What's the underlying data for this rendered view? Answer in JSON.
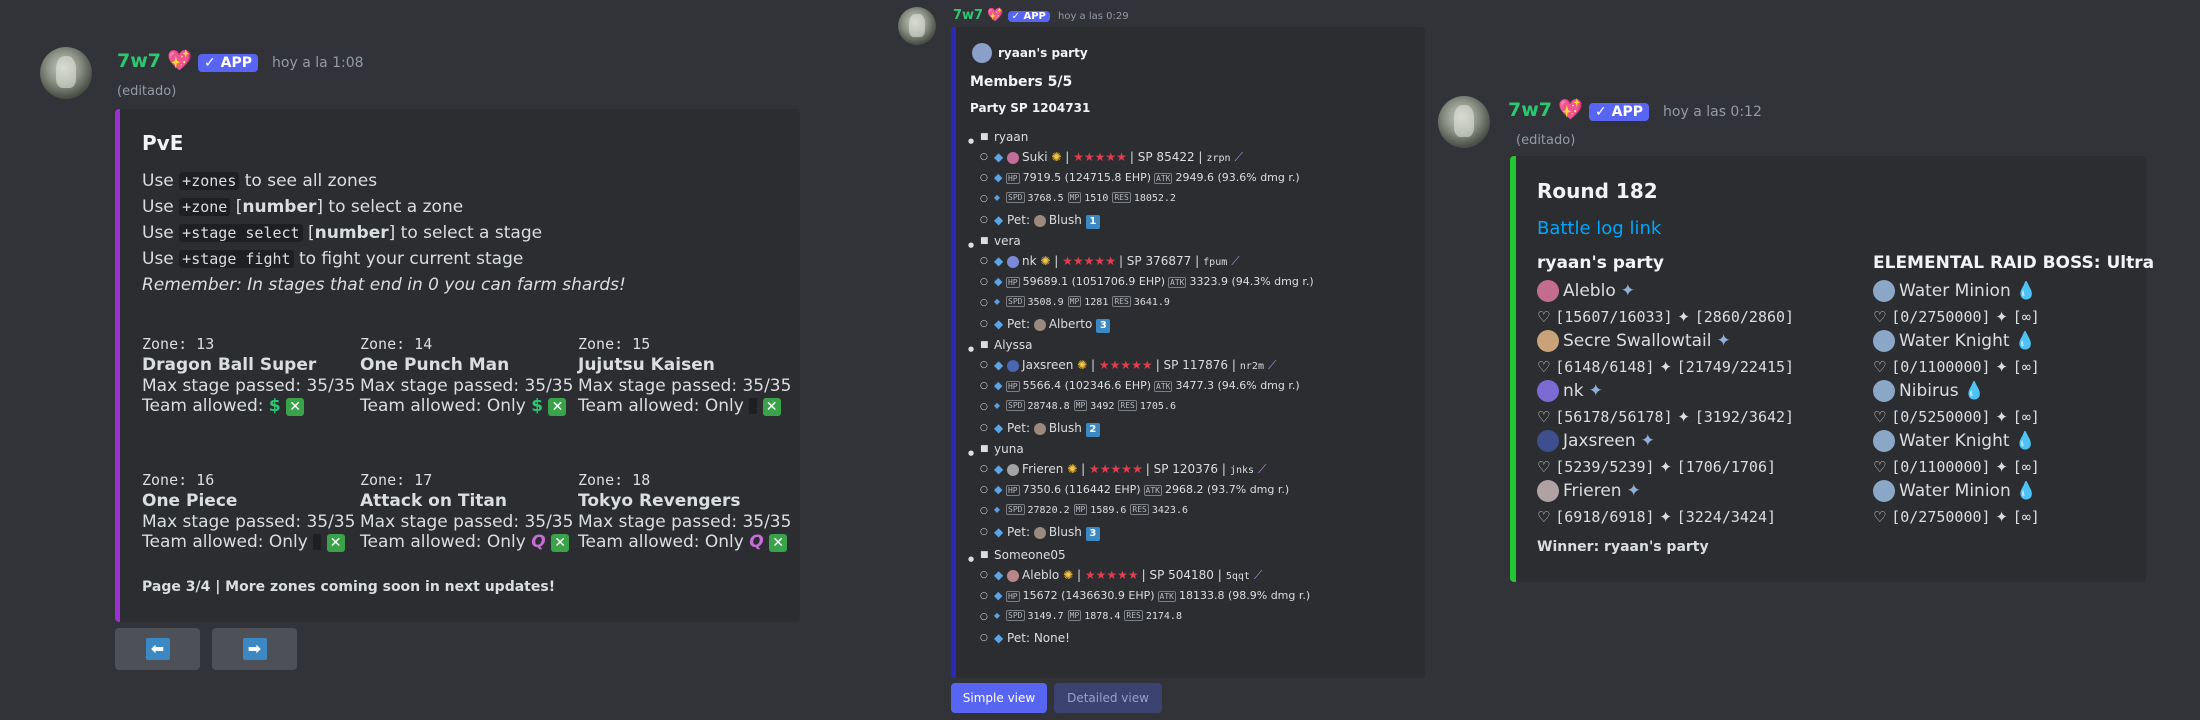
{
  "colors": {
    "background": "#313338",
    "embed_bg": "#2b2d31",
    "pve_border": "#9b2fd4",
    "party_border": "#2a2ab8",
    "round_border": "#22c832",
    "username": "#2dc770",
    "app_badge": "#5865f2",
    "link": "#00a8fc"
  },
  "msg1": {
    "username": "7w7",
    "badge": "APP",
    "timestamp": "hoy a la 1:08",
    "edited": "(editado)",
    "embed": {
      "title": "PvE",
      "lines": [
        {
          "a": "Use ",
          "code": "+zones",
          "b": " to see all zones"
        },
        {
          "a": "Use ",
          "code": "+zone",
          "b": " [",
          "bold": "number",
          "c": "] to select a zone"
        },
        {
          "a": "Use ",
          "code": "+stage select",
          "b": " [",
          "bold": "number",
          "c": "] to select a stage"
        },
        {
          "a": "Use ",
          "code": "+stage fight",
          "b": " to fight your current stage"
        }
      ],
      "remember": "Remember: In stages that end in 0 you can farm shards!",
      "zones": [
        {
          "zone": "Zone: 13",
          "name": "Dragon Ball Super",
          "passed": "Max stage passed: 35/35",
          "team": "Team allowed: ",
          "team_icon": "$",
          "only": ""
        },
        {
          "zone": "Zone: 14",
          "name": "One Punch Man",
          "passed": "Max stage passed: 35/35",
          "team": "Team allowed: Only ",
          "team_icon": "$",
          "only": ""
        },
        {
          "zone": "Zone: 15",
          "name": "Jujutsu Kaisen",
          "passed": "Max stage passed: 35/35",
          "team": "Team allowed: Only ",
          "team_icon": "",
          "only": ""
        },
        {
          "zone": "Zone: 16",
          "name": "One Piece",
          "passed": "Max stage passed: 35/35",
          "team": "Team allowed: Only ",
          "team_icon": "",
          "only": ""
        },
        {
          "zone": "Zone: 17",
          "name": "Attack on Titan",
          "passed": "Max stage passed: 35/35",
          "team": "Team allowed: Only ",
          "team_icon": "Q",
          "only": ""
        },
        {
          "zone": "Zone: 18",
          "name": "Tokyo Revengers",
          "passed": "Max stage passed: 35/35",
          "team": "Team allowed: Only ",
          "team_icon": "Q",
          "only": ""
        }
      ],
      "x_mark": "✕",
      "footer": "Page 3/4 | More zones coming soon in next updates!"
    },
    "buttons": [
      {
        "icon": "left-arrow-icon",
        "glyph": "⬅"
      },
      {
        "icon": "right-arrow-icon",
        "glyph": "➡"
      }
    ]
  },
  "msg2": {
    "username": "7w7",
    "badge": "APP",
    "timestamp": "hoy a las 0:29",
    "embed": {
      "author": "ryaan's party",
      "members": "Members 5/5",
      "party_sp": "Party SP 1204731",
      "players": [
        {
          "name": "ryaan",
          "char": "Suki",
          "sp": "| SP 85422 |",
          "code": "zrpn",
          "hp": "7919.5 (124715.8 EHP)",
          "atk": "2949.6 (93.6% dmg r.)",
          "spd": "3768.5",
          "mp": "1510",
          "res": "18052.2",
          "pet": "Blush",
          "petnum": "1"
        },
        {
          "name": "vera",
          "char": "nk",
          "sp": "| SP 376877 |",
          "code": "fpum",
          "hp": "59689.1 (1051706.9 EHP)",
          "atk": "3323.9 (94.3% dmg r.)",
          "spd": "3508.9",
          "mp": "1281",
          "res": "3641.9",
          "pet": "Alberto",
          "petnum": "3"
        },
        {
          "name": "Alyssa",
          "char": "Jaxsreen",
          "sp": "| SP 117876 |",
          "code": "nr2m",
          "hp": "5566.4 (102346.6 EHP)",
          "atk": "3477.3 (94.6% dmg r.)",
          "spd": "28748.8",
          "mp": "3492",
          "res": "1705.6",
          "pet": "Blush",
          "petnum": "2"
        },
        {
          "name": "yuna",
          "char": "Frieren",
          "sp": "| SP 120376 |",
          "code": "jnks",
          "hp": "7350.6 (116442 EHP)",
          "atk": "2968.2 (93.7% dmg r.)",
          "spd": "27820.2",
          "mp": "1589.6",
          "res": "3423.6",
          "pet": "Blush",
          "petnum": "3"
        },
        {
          "name": "Someone05",
          "char": "Aleblo",
          "sp": "| SP 504180 |",
          "code": "5qqt",
          "hp": "15672 (1436630.9 EHP)",
          "atk": "18133.8 (98.9% dmg r.)",
          "spd": "3149.7",
          "mp": "1878.4",
          "res": "2174.8",
          "pet": "None!",
          "petnum": ""
        }
      ],
      "pet_label": "Pet: ",
      "stars": "★★★★★"
    },
    "buttons": {
      "simple": "Simple view",
      "detailed": "Detailed view"
    }
  },
  "msg3": {
    "username": "7w7",
    "badge": "APP",
    "timestamp": "hoy a las 0:12",
    "edited": "(editado)",
    "embed": {
      "title": "Round 182",
      "link": "Battle log link",
      "left_header": "ryaan's party",
      "right_header": "ELEMENTAL RAID BOSS: Ultra",
      "party": [
        {
          "name": "Aleblo",
          "stats": "[15607/16033]",
          "energy": "[2860/2860]"
        },
        {
          "name": "Secre Swallowtail",
          "stats": "[6148/6148]",
          "energy": "[21749/22415]"
        },
        {
          "name": "nk",
          "stats": "[56178/56178]",
          "energy": "[3192/3642]"
        },
        {
          "name": "Jaxsreen",
          "stats": "[5239/5239]",
          "energy": "[1706/1706]"
        },
        {
          "name": "Frieren",
          "stats": "[6918/6918]",
          "energy": "[3224/3424]"
        }
      ],
      "boss": [
        {
          "name": "Water Minion",
          "stats": "[0/2750000]",
          "energy": "[∞]"
        },
        {
          "name": "Water Knight",
          "stats": "[0/1100000]",
          "energy": "[∞]"
        },
        {
          "name": "Nibirus",
          "stats": "[0/5250000]",
          "energy": "[∞]"
        },
        {
          "name": "Water Knight",
          "stats": "[0/1100000]",
          "energy": "[∞]"
        },
        {
          "name": "Water Minion",
          "stats": "[0/2750000]",
          "energy": "[∞]"
        }
      ],
      "winner": "Winner: ryaan's party"
    }
  }
}
